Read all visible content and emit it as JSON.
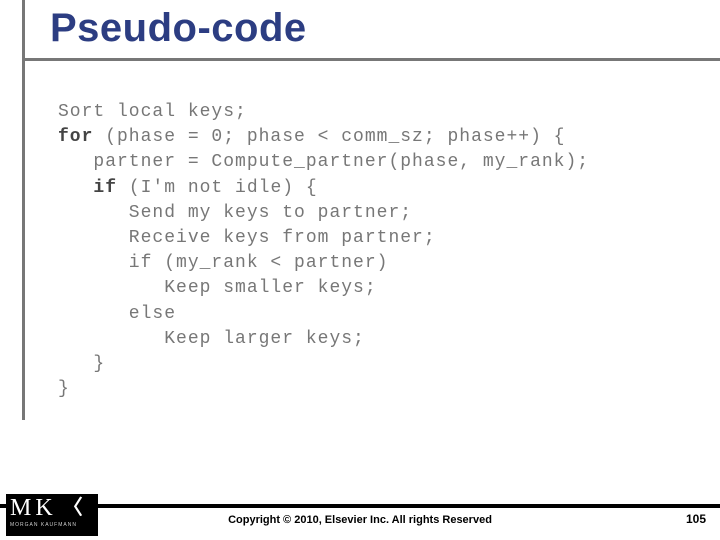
{
  "title": "Pseudo-code",
  "code": {
    "l1": "Sort local keys;",
    "kw_for": "for",
    "l2": " (phase = 0; phase < comm_sz; phase++) {",
    "l3": "   partner = Compute_partner(phase, my_rank);",
    "kw_if": "if",
    "l4_pre": "   ",
    "l4": " (I'm not idle) {",
    "l5": "      Send my keys to partner;",
    "l6": "      Receive keys from partner;",
    "l7": "      if (my_rank < partner)",
    "l8": "         Keep smaller keys;",
    "l9": "      else",
    "l10": "         Keep larger keys;",
    "l11": "   }",
    "l12": "}"
  },
  "logo": {
    "mk": "MK",
    "angle": "〈",
    "sub": "MORGAN KAUFMANN"
  },
  "copyright": "Copyright © 2010, Elsevier Inc. All rights Reserved",
  "page": "105"
}
